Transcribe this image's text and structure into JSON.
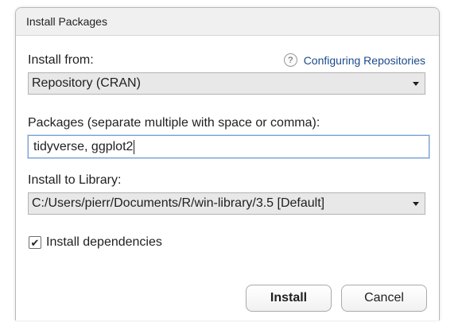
{
  "dialog": {
    "title": "Install Packages"
  },
  "install_from": {
    "label": "Install from:",
    "help_icon": "question-circle-icon",
    "help_link": "Configuring Repositories",
    "selected": "Repository (CRAN)"
  },
  "packages": {
    "label": "Packages (separate multiple with space or comma):",
    "value": "tidyverse, ggplot2"
  },
  "library": {
    "label": "Install to Library:",
    "selected": "C:/Users/pierr/Documents/R/win-library/3.5 [Default]"
  },
  "dependencies": {
    "label": "Install dependencies",
    "checked": true
  },
  "buttons": {
    "install": "Install",
    "cancel": "Cancel"
  }
}
